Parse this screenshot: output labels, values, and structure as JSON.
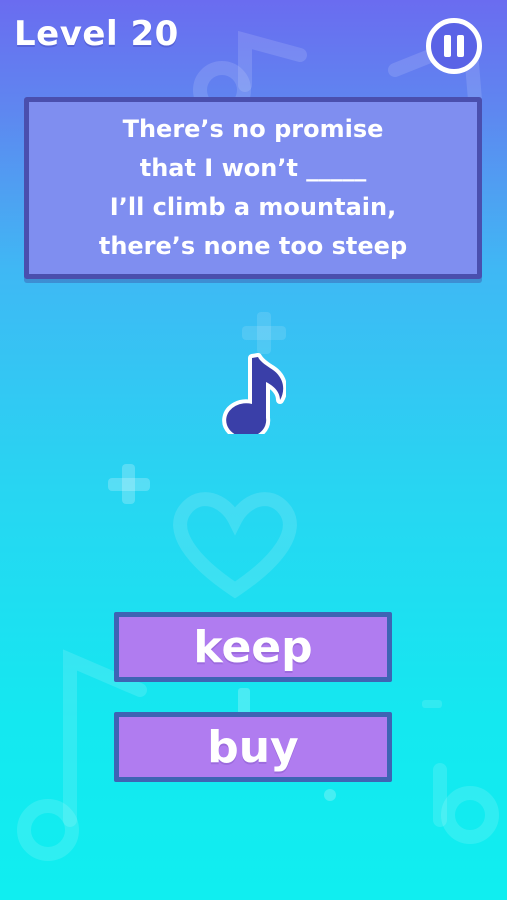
{
  "header": {
    "level_title": "Level 20"
  },
  "lyrics": {
    "lines": [
      "There’s no promise",
      "that I won’t _____",
      "I’ll climb a mountain,",
      "there’s none too steep"
    ]
  },
  "answers": [
    {
      "label": "keep"
    },
    {
      "label": "buy"
    }
  ],
  "colors": {
    "lyrics_box": "#7f8ef0",
    "lyrics_border": "#4a4fae",
    "answer_fill": "#b07cf0",
    "answer_border": "#3e64b4",
    "note": "#3a3fa8"
  },
  "icons": {
    "pause": "pause-icon",
    "note": "music-note-icon"
  }
}
